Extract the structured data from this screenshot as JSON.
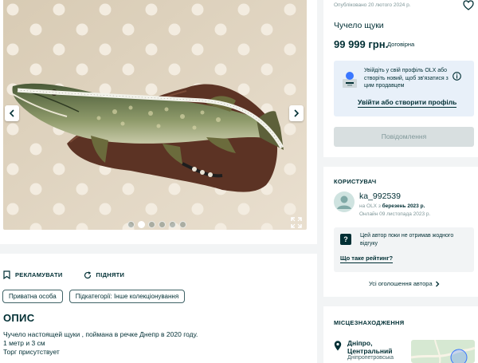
{
  "gallery": {
    "slide_count": 6,
    "active_slide": 1,
    "colors": {
      "wall": "#e4d9c6",
      "wall_dots": "#f3ece0",
      "plaque": "#5c3324"
    }
  },
  "actions": {
    "promote": "РЕКЛАМУВАТИ",
    "raise": "ПІДНЯТИ"
  },
  "tags": [
    "Приватна особа",
    "Підкатегорії: Інше колекціонування"
  ],
  "description": {
    "heading": "ОПИС",
    "lines": [
      "Чучело настоящей щуки , поймана в речке Днепр в 2020 году.",
      "1 метр и 3 см",
      "Торг присутствует"
    ]
  },
  "listing": {
    "published": "Опубліковано 20 лютого 2024 р.",
    "title": "Чучело щуки",
    "price": "99 999 грн.",
    "negotiable": "Договірна"
  },
  "login_prompt": {
    "text": "Увійдіть у свій профіль OLX або створіть новий, щоб зв'язатися з цим продавцем",
    "link": "Увійти або створити профіль"
  },
  "message_button": "Повідомлення",
  "user": {
    "section_label": "КОРИСТУВАЧ",
    "name": "ka_992539",
    "since_prefix": "на OLX з",
    "since_date": "березень 2023 р.",
    "online": "Онлайн 09 листопада 2023 р.",
    "rating_text": "Цей автор поки не отримав жодного відгуку",
    "rating_link": "Що таке рейтинг?",
    "all_ads": "Усі оголошення автора"
  },
  "location": {
    "section_label": "МІСЦЕЗНАХОДЖЕННЯ",
    "city": "Дніпро,",
    "district": "Центральний",
    "region": "Дніпропетровська"
  },
  "colors": {
    "primary": "#002f34",
    "muted": "#7f9799",
    "page_bg": "#f2f4f5",
    "info_bg": "#e8f0f9"
  }
}
